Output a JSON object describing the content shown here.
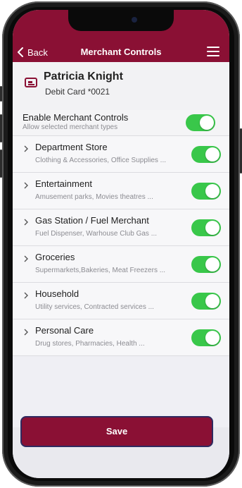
{
  "nav": {
    "back_label": "Back",
    "title": "Merchant Controls"
  },
  "card": {
    "holder_name": "Patricia Knight",
    "card_label": "Debit Card *0021"
  },
  "master": {
    "title": "Enable Merchant Controls",
    "subtitle": "Allow selected merchant types",
    "enabled": true
  },
  "categories": [
    {
      "title": "Department Store",
      "subtitle": "Clothing & Accessories, Office Supplies ...",
      "enabled": true
    },
    {
      "title": "Entertainment",
      "subtitle": "Amusement parks, Movies theatres ...",
      "enabled": true
    },
    {
      "title": "Gas Station / Fuel Merchant",
      "subtitle": "Fuel Dispenser, Warhouse Club Gas ...",
      "enabled": true
    },
    {
      "title": "Groceries",
      "subtitle": "Supermarkets,Bakeries, Meat Freezers ...",
      "enabled": true
    },
    {
      "title": "Household",
      "subtitle": "Utility services, Contracted services ...",
      "enabled": true
    },
    {
      "title": "Personal Care",
      "subtitle": "Drug stores, Pharmacies, Health ...",
      "enabled": true
    }
  ],
  "save_label": "Save",
  "colors": {
    "brand": "#8a1034",
    "toggle_on": "#39c74a",
    "save_outline": "#2f2a60"
  },
  "icons": {
    "back": "chevron-left-icon",
    "menu": "hamburger-menu-icon",
    "card": "credit-card-icon",
    "row": "chevron-right-icon"
  }
}
